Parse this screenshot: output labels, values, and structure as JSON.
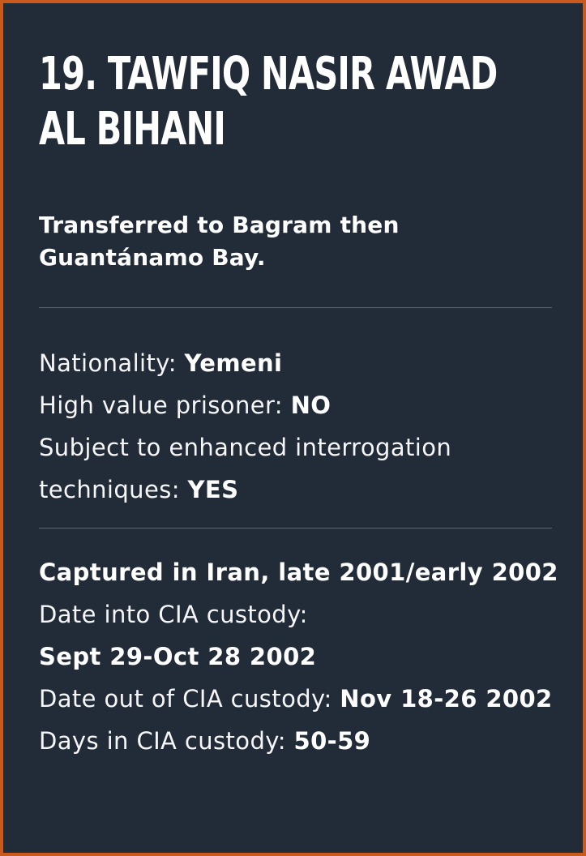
{
  "card": {
    "title_line1": "19. Tawfiq Nasir Awad",
    "title_line2": "al Bihani",
    "subtitle_line1": "Transferred to Bagram then",
    "subtitle_line2": "Guantánamo Bay.",
    "nationality_label": "Nationality: ",
    "nationality_value": "Yemeni",
    "high_value_label": "High value prisoner: ",
    "high_value_value": "NO",
    "eit_label_line1": "Subject to enhanced interrogation",
    "eit_label_line2": "techniques: ",
    "eit_value": "YES",
    "captured": "Captured in Iran, late 2001/early 2002",
    "date_in_label": "Date into CIA custody:",
    "date_in_value": "Sept 29-Oct 28 2002",
    "date_out_label": "Date out of CIA custody: ",
    "date_out_value": "Nov 18-26 2002",
    "days_label": "Days in CIA custody: ",
    "days_value": "50-59"
  },
  "colors": {
    "background": "#222b38",
    "border": "#c85a1e",
    "text": "#ffffff",
    "divider": "#5c6573"
  }
}
